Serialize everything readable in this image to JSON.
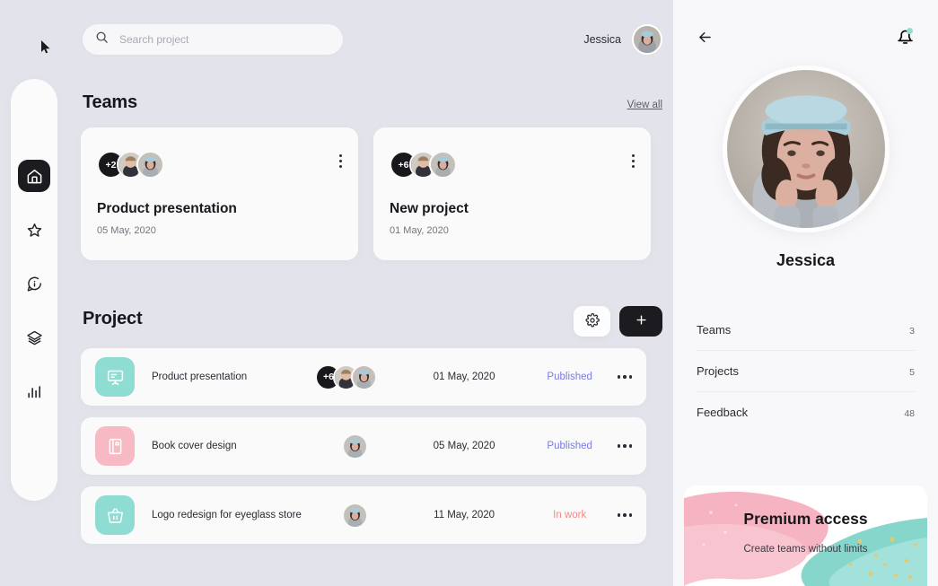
{
  "search": {
    "placeholder": "Search project",
    "value": "",
    "icon": "search-icon"
  },
  "header": {
    "user_name": "Jessica",
    "avatar": "user-avatar"
  },
  "sidebar": {
    "items": [
      {
        "icon": "home-icon",
        "name": "home",
        "active": true
      },
      {
        "icon": "star-icon",
        "name": "favorites",
        "active": false
      },
      {
        "icon": "info-chat-icon",
        "name": "info",
        "active": false
      },
      {
        "icon": "layers-icon",
        "name": "layers",
        "active": false
      },
      {
        "icon": "chart-bar-icon",
        "name": "analytics",
        "active": false
      }
    ]
  },
  "teams": {
    "title": "Teams",
    "view_all": "View all",
    "cards": [
      {
        "members_extra": "+2",
        "title": "Product presentation",
        "date": "05 May, 2020"
      },
      {
        "members_extra": "+6",
        "title": "New project",
        "date": "01 May, 2020"
      }
    ]
  },
  "project": {
    "title": "Project",
    "settings_label": "settings",
    "add_label": "+",
    "rows": [
      {
        "icon": "presentation-icon",
        "icon_color": "#8fdcd2",
        "name": "Product presentation",
        "members_extra": "+6",
        "date": "01 May, 2020",
        "status": "Published",
        "status_color": "#7b7be0"
      },
      {
        "icon": "book-icon",
        "icon_color": "#f7b9c4",
        "name": "Book cover design",
        "members_extra": "",
        "date": "05 May, 2020",
        "status": "Published",
        "status_color": "#7b7be0"
      },
      {
        "icon": "basket-icon",
        "icon_color": "#8fdcd2",
        "name": "Logo redesign for eyeglass store",
        "members_extra": "",
        "date": "11 May, 2020",
        "status": "In work",
        "status_color": "#f08a8a"
      }
    ]
  },
  "panel": {
    "back_icon": "arrow-left-icon",
    "bell_icon": "bell-icon",
    "name": "Jessica",
    "stats": [
      {
        "label": "Teams",
        "value": "3"
      },
      {
        "label": "Projects",
        "value": "5"
      },
      {
        "label": "Feedback",
        "value": "48"
      }
    ],
    "promo": {
      "title": "Premium access",
      "subtitle": "Create teams without limits",
      "pink": "#f8b6c4",
      "teal": "#86d6cb",
      "gold": "#e8c96a"
    }
  },
  "colors": {
    "background": "#e3e4eb",
    "surface": "#fafafb",
    "panel": "#f8f8fa",
    "dark": "#1c1c20",
    "published": "#7b7be0",
    "inwork": "#f08a8a",
    "teal": "#8fdcd2",
    "pink": "#f7b9c4"
  }
}
